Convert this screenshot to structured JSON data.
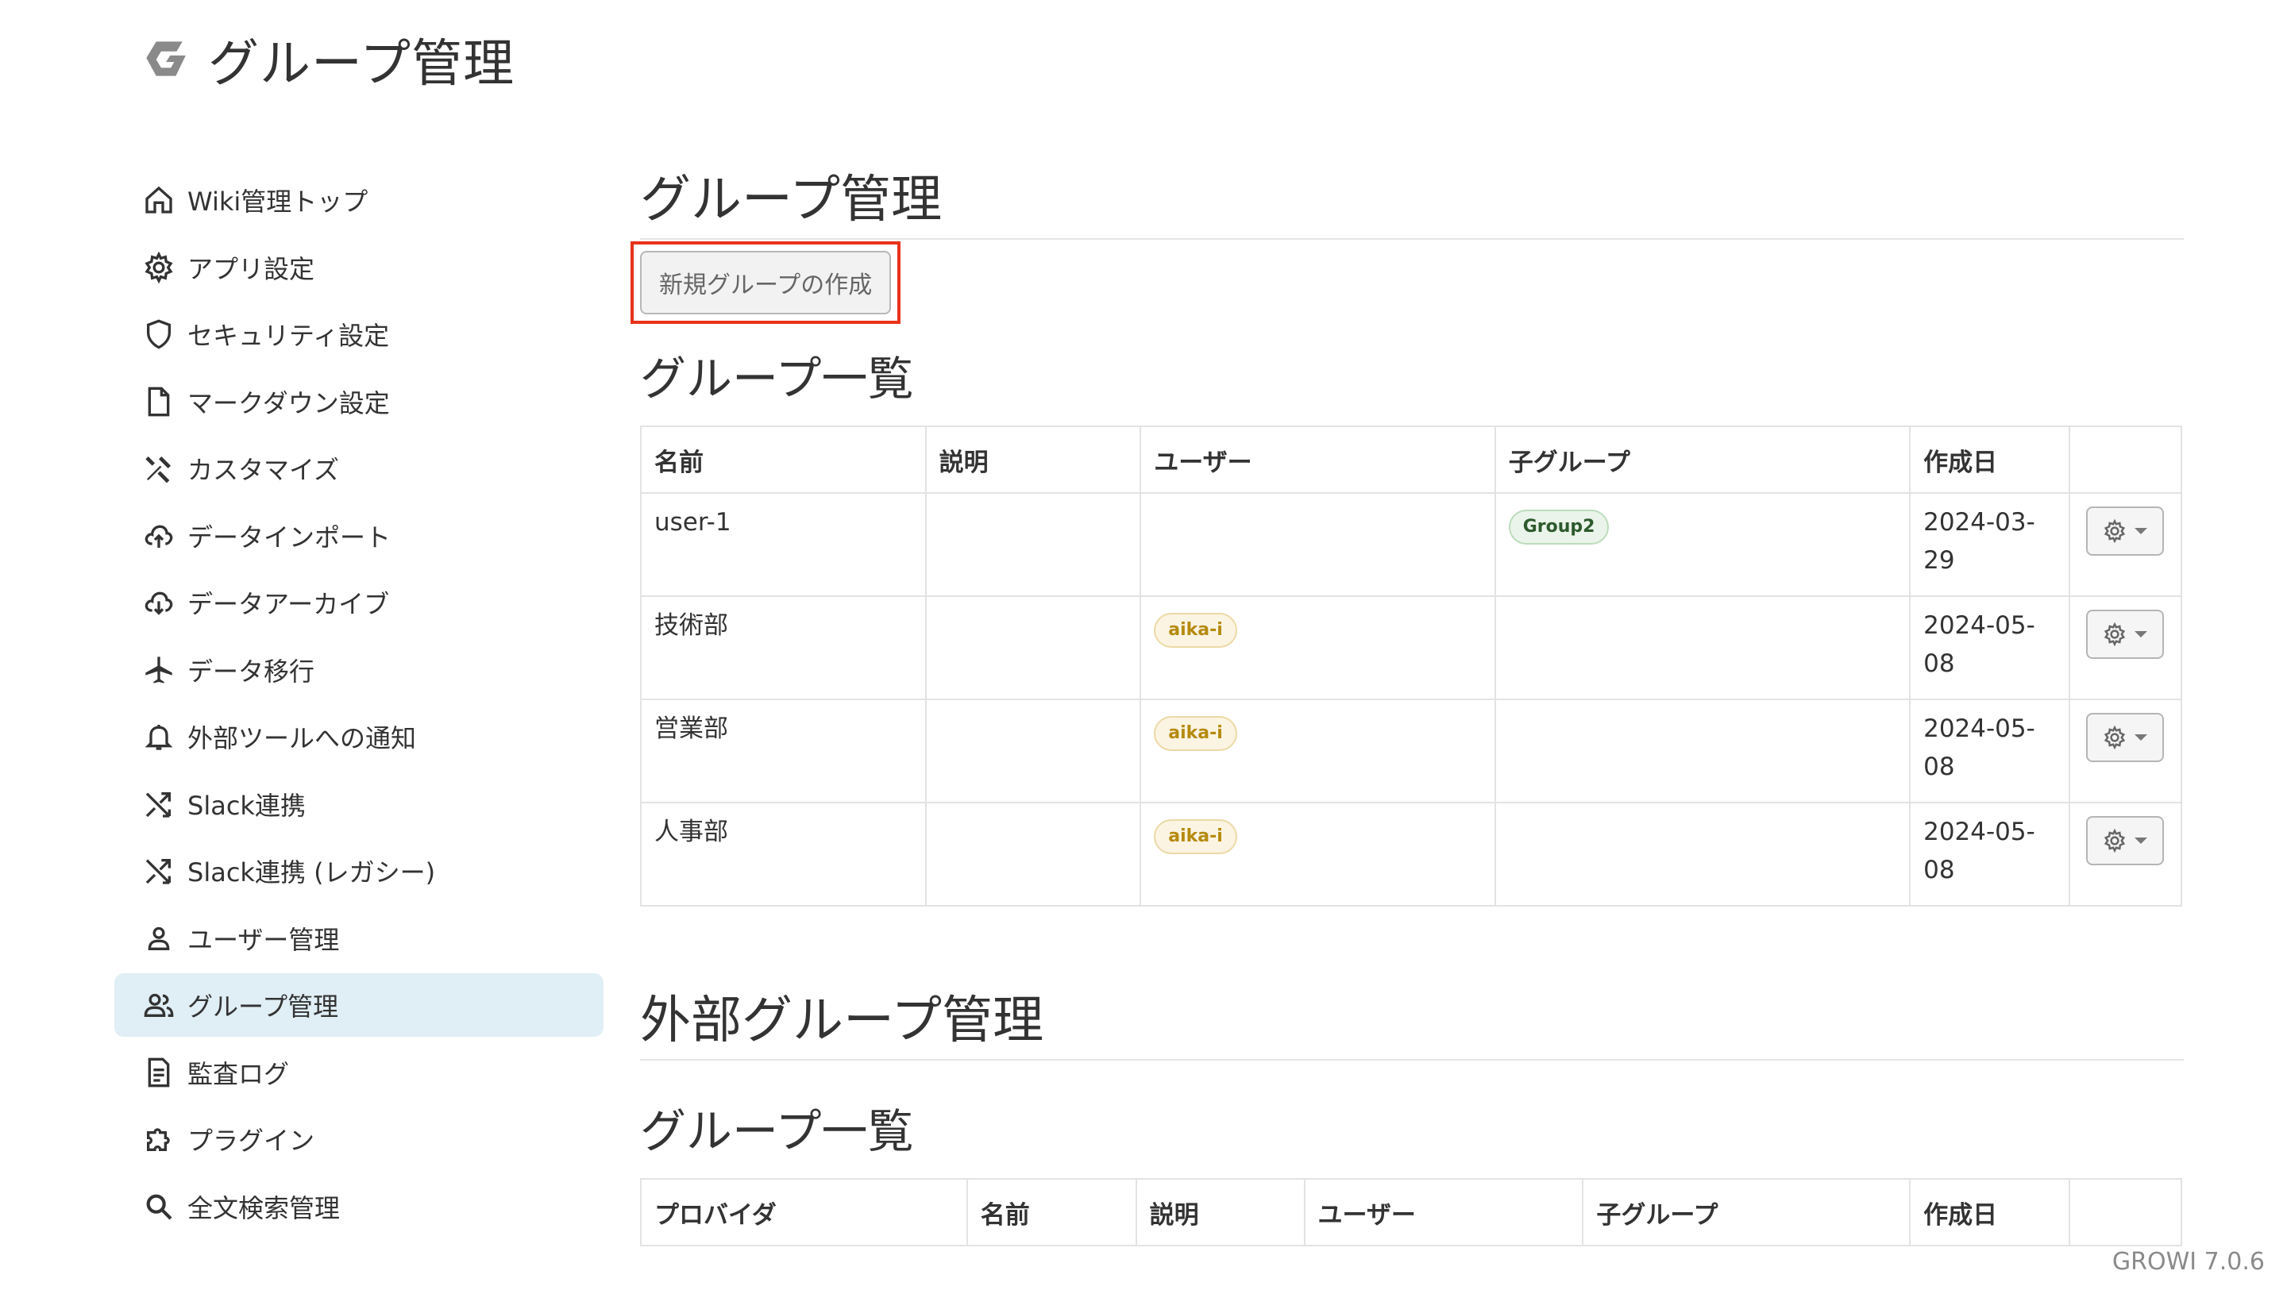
{
  "header": {
    "title": "グループ管理",
    "logo_icon": "growi-logo-icon"
  },
  "sidebar": {
    "items": [
      {
        "label": "Wiki管理トップ",
        "icon": "home-icon"
      },
      {
        "label": "アプリ設定",
        "icon": "gear-icon"
      },
      {
        "label": "セキュリティ設定",
        "icon": "shield-icon"
      },
      {
        "label": "マークダウン設定",
        "icon": "file-icon"
      },
      {
        "label": "カスタマイズ",
        "icon": "tools-icon"
      },
      {
        "label": "データインポート",
        "icon": "cloud-upload-icon"
      },
      {
        "label": "データアーカイブ",
        "icon": "cloud-download-icon"
      },
      {
        "label": "データ移行",
        "icon": "airplane-icon"
      },
      {
        "label": "外部ツールへの通知",
        "icon": "bell-icon"
      },
      {
        "label": "Slack連携",
        "icon": "shuffle-icon"
      },
      {
        "label": "Slack連携 (レガシー)",
        "icon": "shuffle-icon"
      },
      {
        "label": "ユーザー管理",
        "icon": "person-icon"
      },
      {
        "label": "グループ管理",
        "icon": "people-icon",
        "active": true
      },
      {
        "label": "監査ログ",
        "icon": "document-text-icon"
      },
      {
        "label": "プラグイン",
        "icon": "puzzle-icon"
      },
      {
        "label": "全文検索管理",
        "icon": "search-icon"
      }
    ]
  },
  "main": {
    "title": "グループ管理",
    "create_button": "新規グループの作成",
    "list_title": "グループ一覧",
    "columns": [
      "名前",
      "説明",
      "ユーザー",
      "子グループ",
      "作成日",
      ""
    ],
    "rows": [
      {
        "name": "user-1",
        "description": "",
        "users": "",
        "child": "Group2",
        "created": "2024-03-29"
      },
      {
        "name": "技術部",
        "description": "",
        "users": "aika-i",
        "child": "",
        "created": "2024-05-08"
      },
      {
        "name": "営業部",
        "description": "",
        "users": "aika-i",
        "child": "",
        "created": "2024-05-08"
      },
      {
        "name": "人事部",
        "description": "",
        "users": "aika-i",
        "child": "",
        "created": "2024-05-08"
      }
    ],
    "external_title": "外部グループ管理",
    "external_list_title": "グループ一覧",
    "external_columns": [
      "プロバイダ",
      "名前",
      "説明",
      "ユーザー",
      "子グループ",
      "作成日",
      ""
    ]
  },
  "footer": {
    "version": "GROWI 7.0.6"
  },
  "colors": {
    "accent": "#e0eef5",
    "highlight_frame": "#e8331a"
  }
}
